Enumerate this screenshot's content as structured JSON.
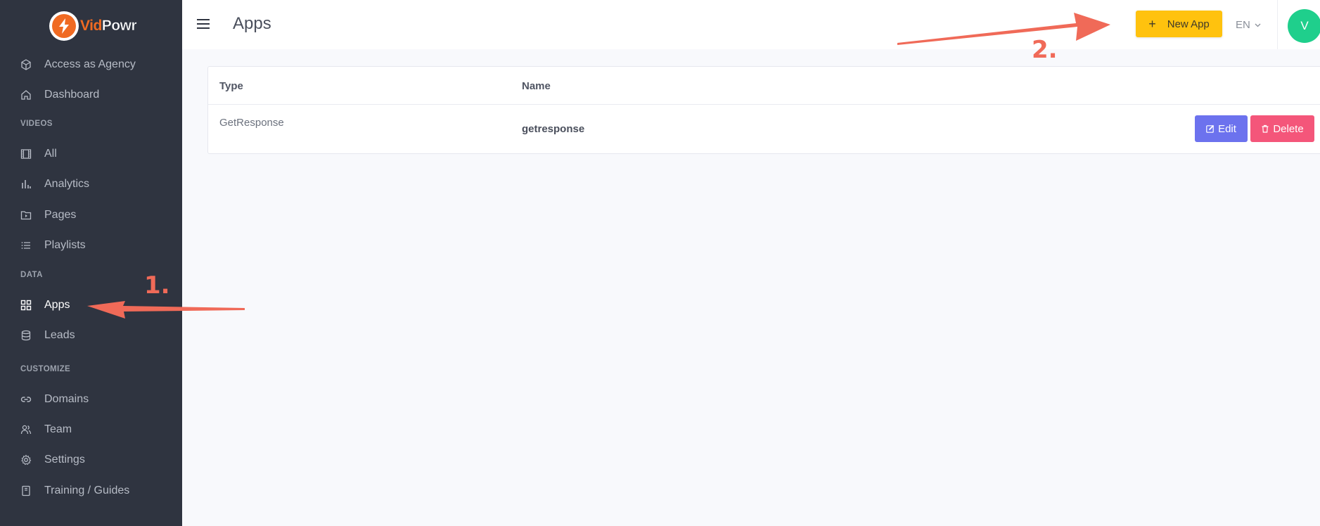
{
  "brand": {
    "vid": "Vid",
    "powr": "Powr"
  },
  "sidebar": {
    "top_items": [
      {
        "label": "Access as Agency",
        "icon": "cube-icon"
      },
      {
        "label": "Dashboard",
        "icon": "home-icon"
      }
    ],
    "sections": [
      {
        "label": "VIDEOS",
        "items": [
          {
            "label": "All",
            "icon": "film-icon"
          },
          {
            "label": "Analytics",
            "icon": "bar-chart-icon"
          },
          {
            "label": "Pages",
            "icon": "folder-play-icon"
          },
          {
            "label": "Playlists",
            "icon": "list-icon"
          }
        ]
      },
      {
        "label": "DATA",
        "items": [
          {
            "label": "Apps",
            "icon": "grid-icon",
            "active": true
          },
          {
            "label": "Leads",
            "icon": "database-icon"
          }
        ]
      },
      {
        "label": "CUSTOMIZE",
        "items": [
          {
            "label": "Domains",
            "icon": "link-icon"
          },
          {
            "label": "Team",
            "icon": "users-icon"
          },
          {
            "label": "Settings",
            "icon": "gear-icon"
          },
          {
            "label": "Training / Guides",
            "icon": "book-icon"
          }
        ]
      }
    ]
  },
  "header": {
    "title": "Apps",
    "new_app_label": "New App",
    "new_app_plus": "+",
    "language": "EN",
    "avatar_initial": "V"
  },
  "table": {
    "columns": [
      "Type",
      "Name"
    ],
    "rows": [
      {
        "type": "GetResponse",
        "name": "getresponse",
        "edit_label": "Edit",
        "delete_label": "Delete"
      }
    ]
  },
  "annotations": {
    "step1": "1.",
    "step2": "2."
  },
  "colors": {
    "sidebar_bg": "#2f3440",
    "accent_yellow": "#ffc20e",
    "edit_purple": "#6c72ee",
    "delete_pink": "#f4567a",
    "avatar_green": "#1fcf8c",
    "annotation_red": "#f06a58"
  }
}
